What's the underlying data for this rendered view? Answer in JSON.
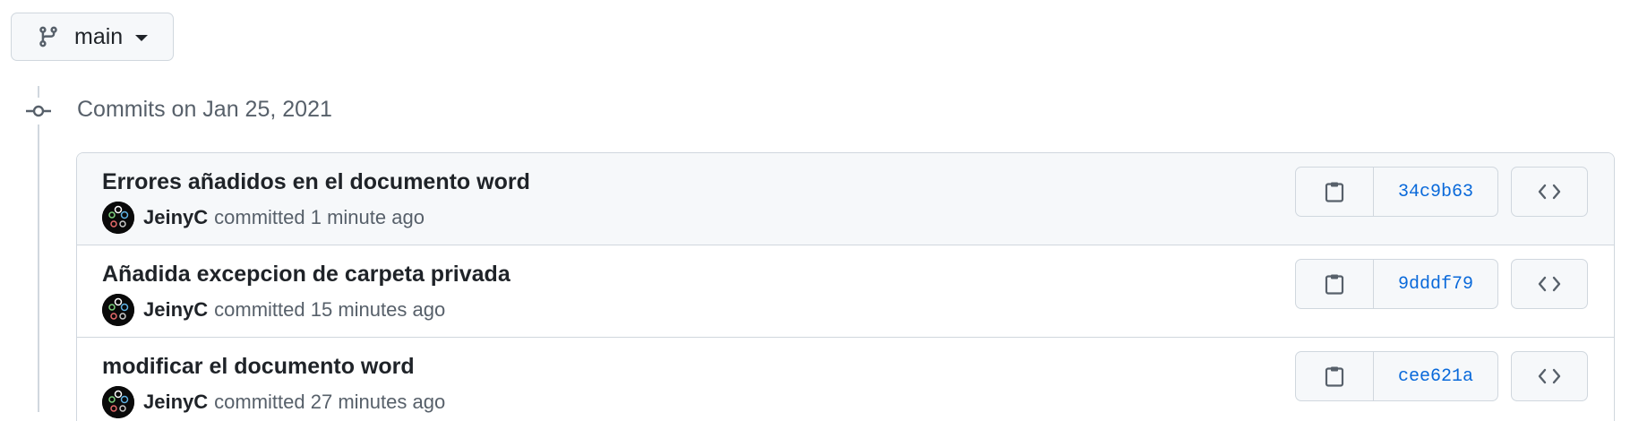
{
  "branch": {
    "icon": "git-branch-icon",
    "name": "main"
  },
  "timeline": {
    "icon": "git-commit-icon",
    "group_title": "Commits on Jan 25, 2021"
  },
  "commits": [
    {
      "message": "Errores añadidos en el documento word",
      "author": "JeinyC",
      "committed_text": "committed 1 minute ago",
      "sha": "34c9b63",
      "copy_icon": "clipboard-icon",
      "browse_icon": "code-icon"
    },
    {
      "message": "Añadida excepcion de carpeta privada",
      "author": "JeinyC",
      "committed_text": "committed 15 minutes ago",
      "sha": "9dddf79",
      "copy_icon": "clipboard-icon",
      "browse_icon": "code-icon"
    },
    {
      "message": "modificar el documento word",
      "author": "JeinyC",
      "committed_text": "committed 27 minutes ago",
      "sha": "cee621a",
      "copy_icon": "clipboard-icon",
      "browse_icon": "code-icon"
    }
  ],
  "colors": {
    "link": "#0969da",
    "border": "#d0d7de",
    "muted": "#57606a",
    "button_bg": "#f6f8fa"
  }
}
